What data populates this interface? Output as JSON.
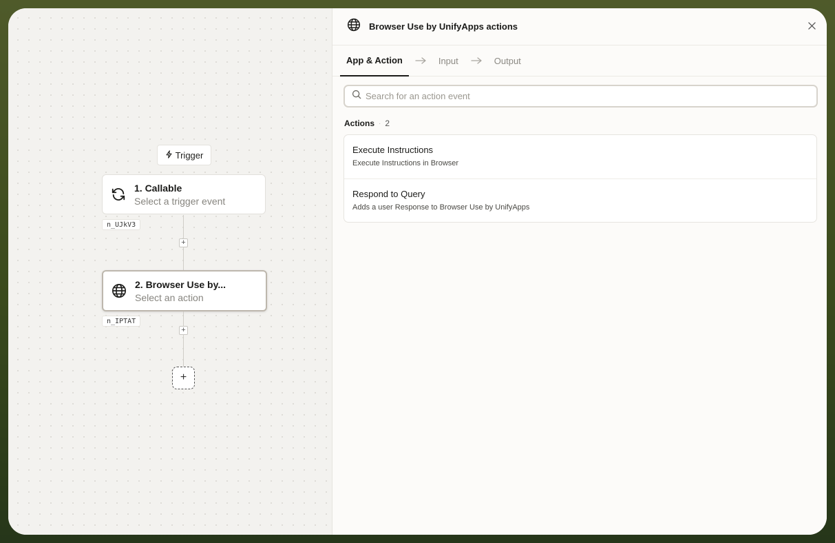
{
  "canvas": {
    "trigger_label": "Trigger",
    "nodes": [
      {
        "title": "1. Callable",
        "subtitle": "Select a trigger event",
        "id": "n_UJkV3",
        "icon": "refresh-icon"
      },
      {
        "title": "2. Browser Use by...",
        "subtitle": "Select an action",
        "id": "n_IPTAT",
        "icon": "globe-icon"
      }
    ],
    "plus_symbol": "+"
  },
  "panel": {
    "title": "Browser Use by UnifyApps actions",
    "tabs": [
      {
        "label": "App & Action",
        "active": true
      },
      {
        "label": "Input",
        "active": false
      },
      {
        "label": "Output",
        "active": false
      }
    ],
    "search": {
      "placeholder": "Search for an action event",
      "value": ""
    },
    "section": {
      "label": "Actions",
      "count": "2"
    },
    "actions": [
      {
        "name": "Execute Instructions",
        "description": "Execute Instructions in Browser"
      },
      {
        "name": "Respond to Query",
        "description": "Adds a user Response to Browser Use by UnifyApps"
      }
    ]
  },
  "colors": {
    "outer_background": "#3a4a1c",
    "canvas_background": "#f3f2ef",
    "panel_background": "#fcfbf9",
    "text_primary": "#1a1a18"
  }
}
